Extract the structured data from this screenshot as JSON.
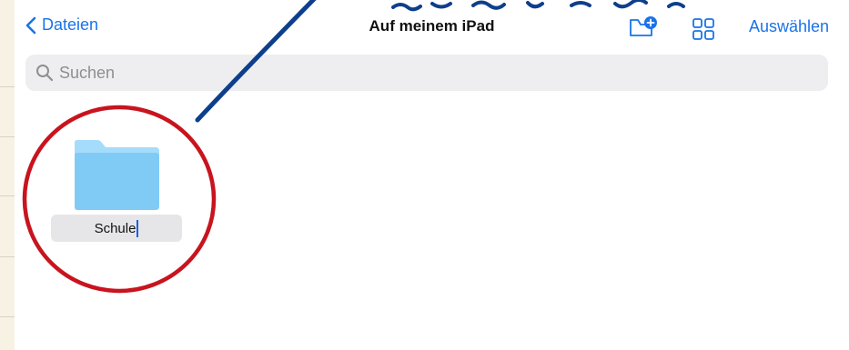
{
  "nav": {
    "back_label": "Dateien",
    "title": "Auf meinem iPad",
    "select_label": "Auswählen",
    "new_folder_icon": "folder-badge-plus-icon",
    "view_icon": "grid-icon"
  },
  "search": {
    "placeholder": "Suchen",
    "value": ""
  },
  "items": [
    {
      "name": "Schule",
      "type": "folder",
      "state": "renaming"
    }
  ],
  "annotation": {
    "circle_color": "#c8141e",
    "arrow_color": "#0d3f8c"
  },
  "colors": {
    "accent": "#1a73e8",
    "folder_light": "#a6dcfb",
    "folder_body": "#7fcbf6"
  }
}
